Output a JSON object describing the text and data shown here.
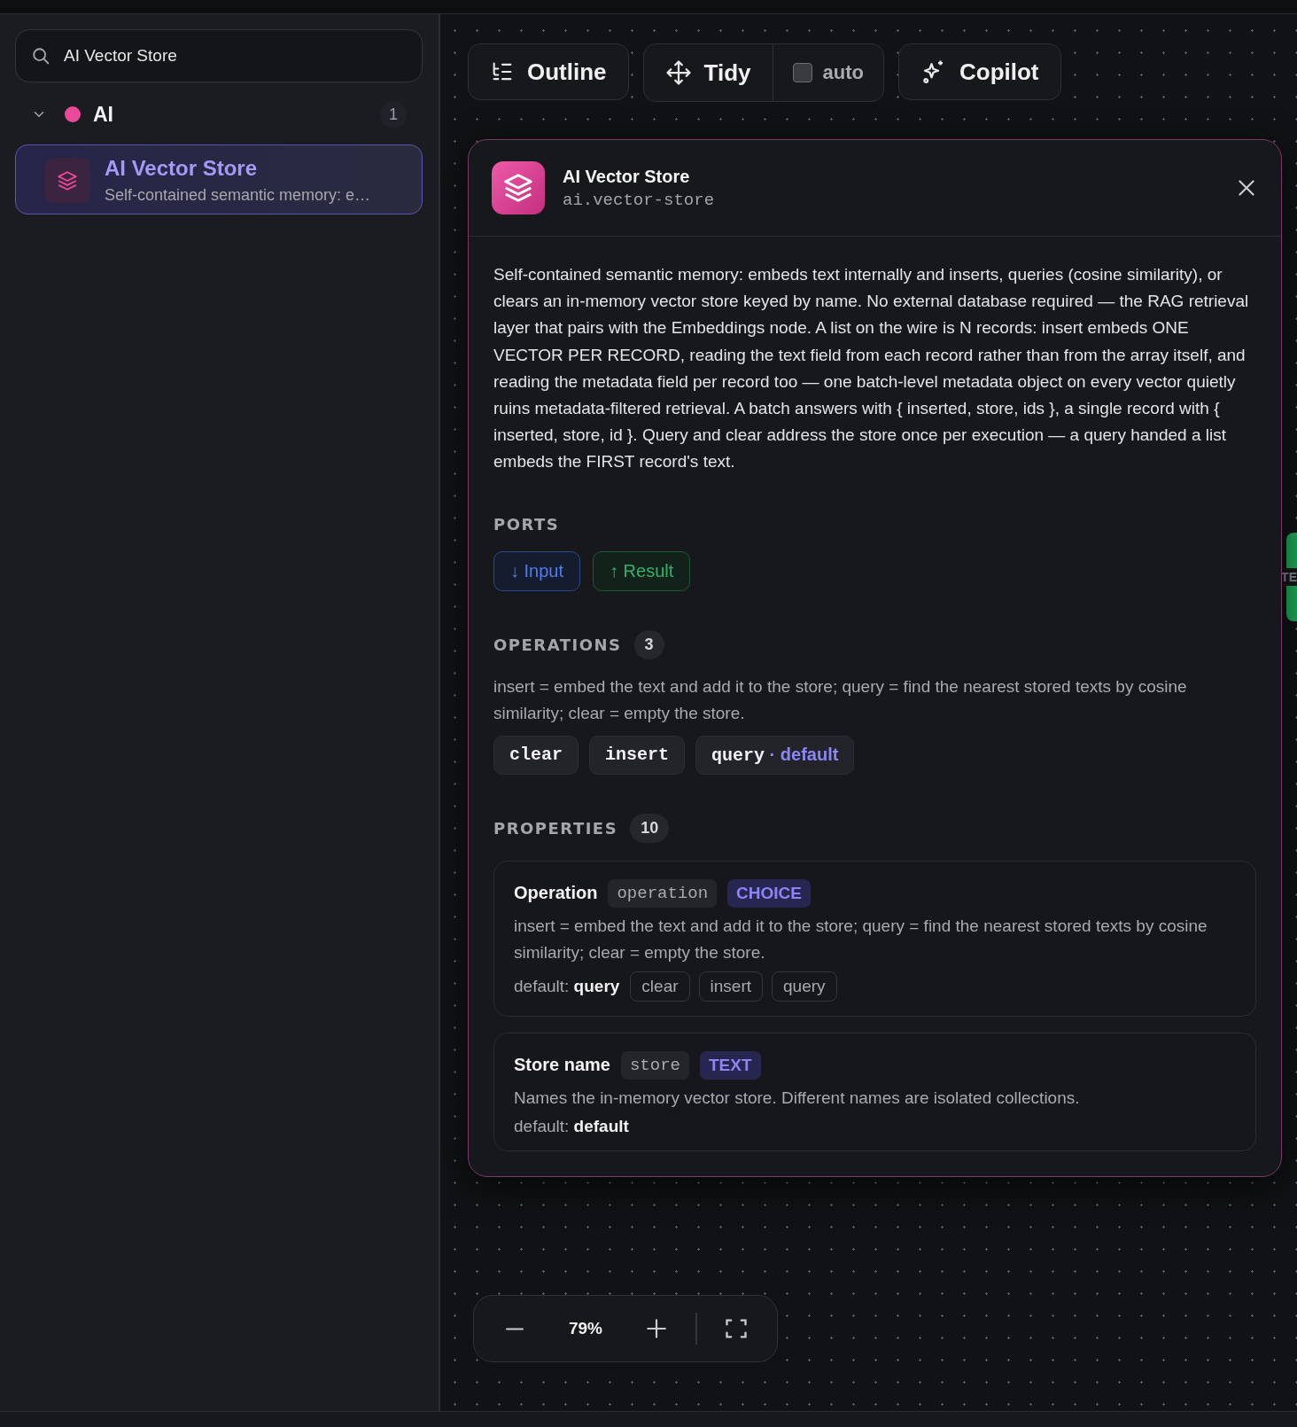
{
  "sidebar": {
    "search": {
      "value": "AI Vector Store"
    },
    "categories": [
      {
        "name": "AI",
        "color": "#ec4899",
        "count": "1",
        "expanded": true,
        "items": [
          {
            "title": "AI Vector Store",
            "description": "Self-contained semantic memory: e…",
            "selected": true
          }
        ]
      }
    ]
  },
  "toolbar": {
    "outline": {
      "label": "Outline"
    },
    "tidy": {
      "label": "Tidy",
      "auto": {
        "label": "auto",
        "checked": false
      }
    },
    "copilot": {
      "label": "Copilot"
    }
  },
  "panel": {
    "title": "AI Vector Store",
    "type_id": "ai.vector-store",
    "description": "Self-contained semantic memory: embeds text internally and inserts, queries (cosine similarity), or clears an in-memory vector store keyed by name. No external database required — the RAG retrieval layer that pairs with the Embeddings node. A list on the wire is N records: insert embeds ONE VECTOR PER RECORD, reading the text field from each record rather than from the array itself, and reading the metadata field per record too — one batch-level metadata object on every vector quietly ruins metadata-filtered retrieval. A batch answers with { inserted, store, ids }, a single record with { inserted, store, id }. Query and clear address the store once per execution — a query handed a list embeds the FIRST record's text.",
    "ports": {
      "heading": "PORTS",
      "items": [
        {
          "label": "↓ Input",
          "kind": "input"
        },
        {
          "label": "↑ Result",
          "kind": "output"
        }
      ]
    },
    "operations": {
      "heading": "OPERATIONS",
      "count": "3",
      "description": "insert = embed the text and add it to the store; query = find the nearest stored texts by cosine similarity; clear = empty the store.",
      "default_marker": "· default",
      "items": [
        {
          "name": "clear",
          "is_default": false
        },
        {
          "name": "insert",
          "is_default": false
        },
        {
          "name": "query",
          "is_default": true
        }
      ]
    },
    "properties": {
      "heading": "PROPERTIES",
      "count": "10",
      "items": [
        {
          "label": "Operation",
          "key": "operation",
          "type": "CHOICE",
          "description": "insert = embed the text and add it to the store; query = find the nearest stored texts by cosine similarity; clear = empty the store.",
          "default_label": "default:",
          "default_value": "query",
          "options": [
            "clear",
            "insert",
            "query"
          ]
        },
        {
          "label": "Store name",
          "key": "store",
          "type": "TEXT",
          "description": "Names the in-memory vector store. Different names are isolated collections.",
          "default_label": "default:",
          "default_value": "default"
        }
      ]
    }
  },
  "edge_node": {
    "text": "TE"
  },
  "zoom": {
    "reading": "79%"
  }
}
